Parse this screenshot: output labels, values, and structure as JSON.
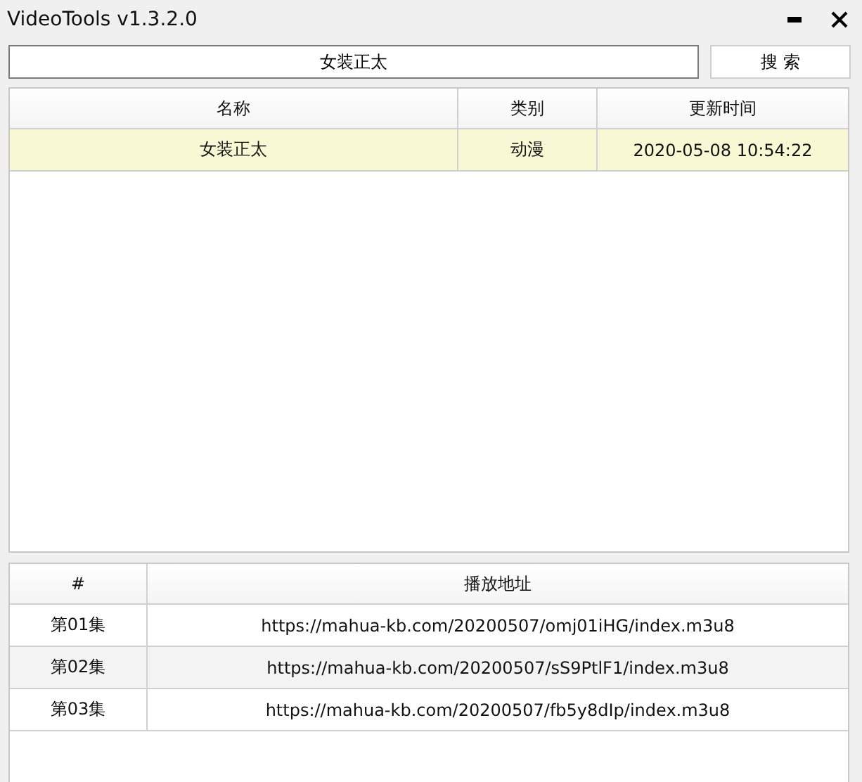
{
  "window": {
    "title": "VideoTools v1.3.2.0",
    "buttons": [
      {
        "kind": "minimize"
      },
      {
        "kind": "close"
      }
    ]
  },
  "search": {
    "value": "女装正太",
    "button": "搜 索"
  },
  "results": {
    "columns": [
      "名称",
      "类别",
      "更新时间"
    ],
    "rows": [
      {
        "cells": [
          "女装正太",
          "动漫",
          "2020-05-08 10:54:22"
        ],
        "selected": true
      }
    ]
  },
  "episodes": {
    "columns": [
      "#",
      "播放地址"
    ],
    "rows": [
      {
        "cells": [
          "第01集",
          "https://mahua-kb.com/20200507/omj01iHG/index.m3u8"
        ]
      },
      {
        "cells": [
          "第02集",
          "https://mahua-kb.com/20200507/sS9PtlF1/index.m3u8"
        ]
      },
      {
        "cells": [
          "第03集",
          "https://mahua-kb.com/20200507/fb5y8dIp/index.m3u8"
        ]
      }
    ]
  }
}
